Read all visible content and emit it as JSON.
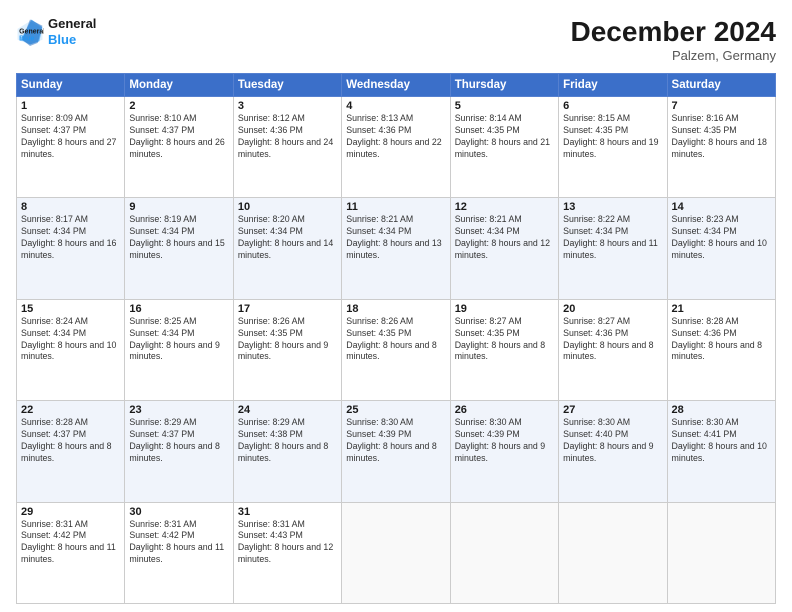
{
  "header": {
    "logo_line1": "General",
    "logo_line2": "Blue",
    "title": "December 2024",
    "subtitle": "Palzem, Germany"
  },
  "columns": [
    "Sunday",
    "Monday",
    "Tuesday",
    "Wednesday",
    "Thursday",
    "Friday",
    "Saturday"
  ],
  "weeks": [
    [
      {
        "day": "1",
        "sunrise": "Sunrise: 8:09 AM",
        "sunset": "Sunset: 4:37 PM",
        "daylight": "Daylight: 8 hours and 27 minutes."
      },
      {
        "day": "2",
        "sunrise": "Sunrise: 8:10 AM",
        "sunset": "Sunset: 4:37 PM",
        "daylight": "Daylight: 8 hours and 26 minutes."
      },
      {
        "day": "3",
        "sunrise": "Sunrise: 8:12 AM",
        "sunset": "Sunset: 4:36 PM",
        "daylight": "Daylight: 8 hours and 24 minutes."
      },
      {
        "day": "4",
        "sunrise": "Sunrise: 8:13 AM",
        "sunset": "Sunset: 4:36 PM",
        "daylight": "Daylight: 8 hours and 22 minutes."
      },
      {
        "day": "5",
        "sunrise": "Sunrise: 8:14 AM",
        "sunset": "Sunset: 4:35 PM",
        "daylight": "Daylight: 8 hours and 21 minutes."
      },
      {
        "day": "6",
        "sunrise": "Sunrise: 8:15 AM",
        "sunset": "Sunset: 4:35 PM",
        "daylight": "Daylight: 8 hours and 19 minutes."
      },
      {
        "day": "7",
        "sunrise": "Sunrise: 8:16 AM",
        "sunset": "Sunset: 4:35 PM",
        "daylight": "Daylight: 8 hours and 18 minutes."
      }
    ],
    [
      {
        "day": "8",
        "sunrise": "Sunrise: 8:17 AM",
        "sunset": "Sunset: 4:34 PM",
        "daylight": "Daylight: 8 hours and 16 minutes."
      },
      {
        "day": "9",
        "sunrise": "Sunrise: 8:19 AM",
        "sunset": "Sunset: 4:34 PM",
        "daylight": "Daylight: 8 hours and 15 minutes."
      },
      {
        "day": "10",
        "sunrise": "Sunrise: 8:20 AM",
        "sunset": "Sunset: 4:34 PM",
        "daylight": "Daylight: 8 hours and 14 minutes."
      },
      {
        "day": "11",
        "sunrise": "Sunrise: 8:21 AM",
        "sunset": "Sunset: 4:34 PM",
        "daylight": "Daylight: 8 hours and 13 minutes."
      },
      {
        "day": "12",
        "sunrise": "Sunrise: 8:21 AM",
        "sunset": "Sunset: 4:34 PM",
        "daylight": "Daylight: 8 hours and 12 minutes."
      },
      {
        "day": "13",
        "sunrise": "Sunrise: 8:22 AM",
        "sunset": "Sunset: 4:34 PM",
        "daylight": "Daylight: 8 hours and 11 minutes."
      },
      {
        "day": "14",
        "sunrise": "Sunrise: 8:23 AM",
        "sunset": "Sunset: 4:34 PM",
        "daylight": "Daylight: 8 hours and 10 minutes."
      }
    ],
    [
      {
        "day": "15",
        "sunrise": "Sunrise: 8:24 AM",
        "sunset": "Sunset: 4:34 PM",
        "daylight": "Daylight: 8 hours and 10 minutes."
      },
      {
        "day": "16",
        "sunrise": "Sunrise: 8:25 AM",
        "sunset": "Sunset: 4:34 PM",
        "daylight": "Daylight: 8 hours and 9 minutes."
      },
      {
        "day": "17",
        "sunrise": "Sunrise: 8:26 AM",
        "sunset": "Sunset: 4:35 PM",
        "daylight": "Daylight: 8 hours and 9 minutes."
      },
      {
        "day": "18",
        "sunrise": "Sunrise: 8:26 AM",
        "sunset": "Sunset: 4:35 PM",
        "daylight": "Daylight: 8 hours and 8 minutes."
      },
      {
        "day": "19",
        "sunrise": "Sunrise: 8:27 AM",
        "sunset": "Sunset: 4:35 PM",
        "daylight": "Daylight: 8 hours and 8 minutes."
      },
      {
        "day": "20",
        "sunrise": "Sunrise: 8:27 AM",
        "sunset": "Sunset: 4:36 PM",
        "daylight": "Daylight: 8 hours and 8 minutes."
      },
      {
        "day": "21",
        "sunrise": "Sunrise: 8:28 AM",
        "sunset": "Sunset: 4:36 PM",
        "daylight": "Daylight: 8 hours and 8 minutes."
      }
    ],
    [
      {
        "day": "22",
        "sunrise": "Sunrise: 8:28 AM",
        "sunset": "Sunset: 4:37 PM",
        "daylight": "Daylight: 8 hours and 8 minutes."
      },
      {
        "day": "23",
        "sunrise": "Sunrise: 8:29 AM",
        "sunset": "Sunset: 4:37 PM",
        "daylight": "Daylight: 8 hours and 8 minutes."
      },
      {
        "day": "24",
        "sunrise": "Sunrise: 8:29 AM",
        "sunset": "Sunset: 4:38 PM",
        "daylight": "Daylight: 8 hours and 8 minutes."
      },
      {
        "day": "25",
        "sunrise": "Sunrise: 8:30 AM",
        "sunset": "Sunset: 4:39 PM",
        "daylight": "Daylight: 8 hours and 8 minutes."
      },
      {
        "day": "26",
        "sunrise": "Sunrise: 8:30 AM",
        "sunset": "Sunset: 4:39 PM",
        "daylight": "Daylight: 8 hours and 9 minutes."
      },
      {
        "day": "27",
        "sunrise": "Sunrise: 8:30 AM",
        "sunset": "Sunset: 4:40 PM",
        "daylight": "Daylight: 8 hours and 9 minutes."
      },
      {
        "day": "28",
        "sunrise": "Sunrise: 8:30 AM",
        "sunset": "Sunset: 4:41 PM",
        "daylight": "Daylight: 8 hours and 10 minutes."
      }
    ],
    [
      {
        "day": "29",
        "sunrise": "Sunrise: 8:31 AM",
        "sunset": "Sunset: 4:42 PM",
        "daylight": "Daylight: 8 hours and 11 minutes."
      },
      {
        "day": "30",
        "sunrise": "Sunrise: 8:31 AM",
        "sunset": "Sunset: 4:42 PM",
        "daylight": "Daylight: 8 hours and 11 minutes."
      },
      {
        "day": "31",
        "sunrise": "Sunrise: 8:31 AM",
        "sunset": "Sunset: 4:43 PM",
        "daylight": "Daylight: 8 hours and 12 minutes."
      },
      null,
      null,
      null,
      null
    ]
  ]
}
